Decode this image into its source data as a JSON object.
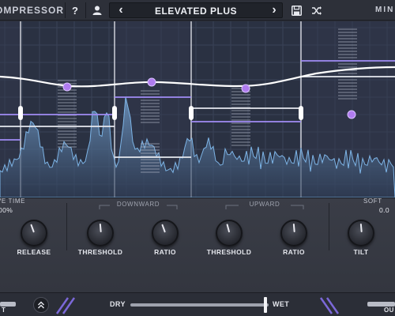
{
  "header": {
    "plugin_title": "OMPRESSOR",
    "help_label": "?",
    "preset_name": "ELEVATED PLUS",
    "prev_label": "‹",
    "next_label": "›",
    "mini_label": "MIN"
  },
  "icons": {
    "help": "question-icon",
    "user": "user-icon",
    "prev": "chevron-left-icon",
    "next": "chevron-right-icon",
    "save": "save-icon",
    "random": "shuffle-icon",
    "collapse": "chevron-double-up-icon"
  },
  "controls": {
    "release": {
      "top_label": "VE TIME",
      "top_value": "00%",
      "label": "RELEASE",
      "level": 0.45
    },
    "downward_group": "DOWNWARD",
    "upward_group": "UPWARD",
    "down_threshold": {
      "label": "THRESHOLD",
      "level": 0.5
    },
    "down_ratio": {
      "label": "RATIO",
      "level": 0.45
    },
    "up_threshold": {
      "label": "THRESHOLD",
      "level": 0.45
    },
    "up_ratio": {
      "label": "RATIO",
      "level": 0.5
    },
    "tilt": {
      "top_label": "SOFT",
      "top_value": "0.0",
      "label": "TILT",
      "level": 0.5
    }
  },
  "bottom": {
    "dry_label": "DRY",
    "wet_label": "WET",
    "drywet": 0.98,
    "left_edge_label": "T",
    "right_edge_label": "OU"
  },
  "colors": {
    "accent": "#8a6ae0",
    "handle_purple": "#b07cf0",
    "spectrum": "#6ea7d6",
    "band_line": "#9a7ef0"
  }
}
